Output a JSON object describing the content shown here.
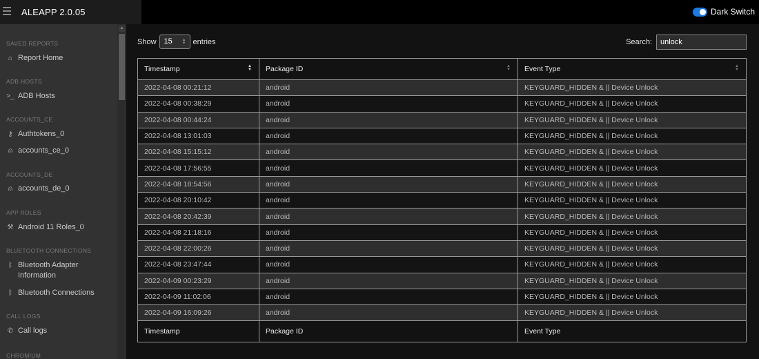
{
  "app": {
    "title": "ALEAPP 2.0.05",
    "dark_switch_label": "Dark Switch"
  },
  "sidebar": {
    "sections": [
      {
        "title": "SAVED REPORTS",
        "items": [
          {
            "label": "Report Home",
            "icon": "home-icon"
          }
        ]
      },
      {
        "title": "ADB HOSTS",
        "items": [
          {
            "label": "ADB Hosts",
            "icon": "terminal-icon"
          }
        ]
      },
      {
        "title": "ACCOUNTS_CE",
        "items": [
          {
            "label": "Authtokens_0",
            "icon": "key-icon"
          },
          {
            "label": "accounts_ce_0",
            "icon": "user-icon"
          }
        ]
      },
      {
        "title": "ACCOUNTS_DE",
        "items": [
          {
            "label": "accounts_de_0",
            "icon": "user-icon"
          }
        ]
      },
      {
        "title": "APP ROLES",
        "items": [
          {
            "label": "Android 11 Roles_0",
            "icon": "tool-icon"
          }
        ]
      },
      {
        "title": "BLUETOOTH CONNECTIONS",
        "items": [
          {
            "label": "Bluetooth Adapter Information",
            "icon": "bluetooth-icon"
          },
          {
            "label": "Bluetooth Connections",
            "icon": "bluetooth-icon"
          }
        ]
      },
      {
        "title": "CALL LOGS",
        "items": [
          {
            "label": "Call logs",
            "icon": "phone-icon"
          }
        ]
      },
      {
        "title": "CHROMIUM",
        "items": []
      }
    ]
  },
  "controls": {
    "show_label": "Show",
    "entries_value": "15",
    "entries_label": "entries",
    "search_label": "Search:",
    "search_value": "unlock"
  },
  "table": {
    "columns": [
      "Timestamp",
      "Package ID",
      "Event Type"
    ],
    "rows": [
      [
        "2022-04-08 00:21:12",
        "android",
        "KEYGUARD_HIDDEN & || Device Unlock"
      ],
      [
        "2022-04-08 00:38:29",
        "android",
        "KEYGUARD_HIDDEN & || Device Unlock"
      ],
      [
        "2022-04-08 00:44:24",
        "android",
        "KEYGUARD_HIDDEN & || Device Unlock"
      ],
      [
        "2022-04-08 13:01:03",
        "android",
        "KEYGUARD_HIDDEN & || Device Unlock"
      ],
      [
        "2022-04-08 15:15:12",
        "android",
        "KEYGUARD_HIDDEN & || Device Unlock"
      ],
      [
        "2022-04-08 17:56:55",
        "android",
        "KEYGUARD_HIDDEN & || Device Unlock"
      ],
      [
        "2022-04-08 18:54:56",
        "android",
        "KEYGUARD_HIDDEN & || Device Unlock"
      ],
      [
        "2022-04-08 20:10:42",
        "android",
        "KEYGUARD_HIDDEN & || Device Unlock"
      ],
      [
        "2022-04-08 20:42:39",
        "android",
        "KEYGUARD_HIDDEN & || Device Unlock"
      ],
      [
        "2022-04-08 21:18:16",
        "android",
        "KEYGUARD_HIDDEN & || Device Unlock"
      ],
      [
        "2022-04-08 22:00:26",
        "android",
        "KEYGUARD_HIDDEN & || Device Unlock"
      ],
      [
        "2022-04-08 23:47:44",
        "android",
        "KEYGUARD_HIDDEN & || Device Unlock"
      ],
      [
        "2022-04-09 00:23:29",
        "android",
        "KEYGUARD_HIDDEN & || Device Unlock"
      ],
      [
        "2022-04-09 11:02:06",
        "android",
        "KEYGUARD_HIDDEN & || Device Unlock"
      ],
      [
        "2022-04-09 16:09:26",
        "android",
        "KEYGUARD_HIDDEN & || Device Unlock"
      ]
    ]
  }
}
